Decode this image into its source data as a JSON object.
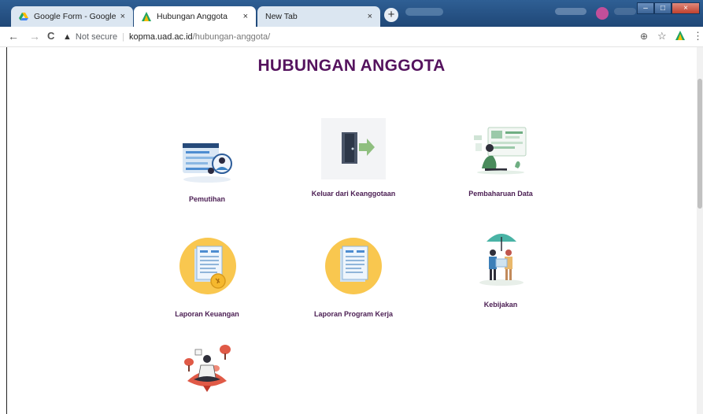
{
  "browser": {
    "tabs": [
      {
        "title": "Google Form - Google Drive",
        "close": "×",
        "active": false
      },
      {
        "title": "Hubungan Anggota",
        "close": "×",
        "active": true
      },
      {
        "title": "New Tab",
        "close": "×",
        "active": false
      }
    ],
    "new_tab": "+",
    "window_controls": {
      "minimize": "–",
      "maximize": "□",
      "close": "×"
    },
    "nav": {
      "back": "←",
      "forward": "→",
      "reload": "C"
    },
    "address": {
      "warning_icon": "▲",
      "security_label": "Not secure",
      "separator": "|",
      "host": "kopma.uad.ac.id",
      "path": "/hubungan-anggota/"
    },
    "toolbar_icons": {
      "zoom": "⊕",
      "bookmark": "☆",
      "menu": "⋮"
    }
  },
  "page": {
    "title": "HUBUNGAN ANGGOTA",
    "items": [
      {
        "label": "Pemutihan",
        "icon": "document-person-icon"
      },
      {
        "label": "Keluar dari Keanggotaan",
        "icon": "exit-door-icon"
      },
      {
        "label": "Pembaharuan Data",
        "icon": "data-update-icon"
      },
      {
        "label": "Laporan Keuangan",
        "icon": "financial-report-icon"
      },
      {
        "label": "Laporan Program Kerja",
        "icon": "work-program-report-icon"
      },
      {
        "label": "Kebijakan",
        "icon": "policy-umbrella-icon"
      },
      {
        "label": "",
        "icon": "meditation-person-icon"
      }
    ]
  },
  "colors": {
    "title": "#55135e",
    "label": "#4a1d52",
    "accent_yellow": "#f9c74f",
    "chrome_blue": "#1f4777"
  }
}
